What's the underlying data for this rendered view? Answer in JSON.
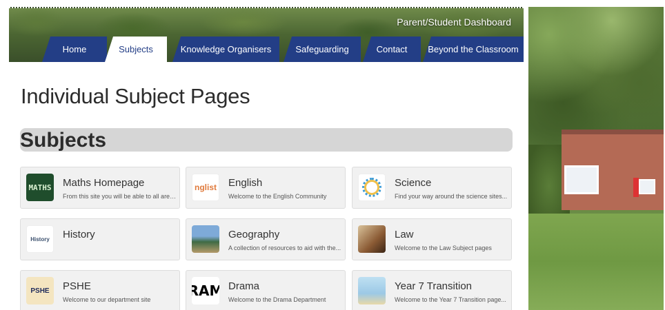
{
  "header": {
    "dashboard_link": "Parent/Student Dashboard",
    "nav": [
      {
        "label": "Home",
        "active": false
      },
      {
        "label": "Subjects",
        "active": true
      },
      {
        "label": "Knowledge Organisers",
        "active": false
      },
      {
        "label": "Safeguarding",
        "active": false
      },
      {
        "label": "Contact",
        "active": false
      },
      {
        "label": "Beyond the Classroom",
        "active": false
      }
    ]
  },
  "main": {
    "page_title": "Individual Subject Pages",
    "section_title": "Subjects",
    "cards": [
      {
        "title": "Maths Homepage",
        "desc": "From this site you will be able to all areas...",
        "thumb_text": "MATHS",
        "icon": "maths-chalkboard-icon"
      },
      {
        "title": "English",
        "desc": "Welcome to the English Community",
        "thumb_text": "nglist",
        "icon": "english-word-icon"
      },
      {
        "title": "Science",
        "desc": "Find your way around the science sites...",
        "thumb_text": "",
        "icon": "science-circle-icon"
      },
      {
        "title": "History",
        "desc": "",
        "thumb_text": "History",
        "icon": "history-collage-icon"
      },
      {
        "title": "Geography",
        "desc": "A collection of resources to aid with the...",
        "thumb_text": "",
        "icon": "geography-landscape-icon"
      },
      {
        "title": "Law",
        "desc": "Welcome to the Law Subject pages",
        "thumb_text": "",
        "icon": "law-gavel-icon"
      },
      {
        "title": "PSHE",
        "desc": "Welcome to our department site",
        "thumb_text": "PSHE",
        "icon": "pshe-puzzle-icon"
      },
      {
        "title": "Drama",
        "desc": "Welcome to the Drama Department",
        "thumb_text": "RAM",
        "icon": "drama-letters-icon"
      },
      {
        "title": "Year 7 Transition",
        "desc": "Welcome to the Year 7 Transition page...",
        "thumb_text": "",
        "icon": "year7-figures-icon"
      }
    ]
  },
  "colors": {
    "nav_blue": "#233e86",
    "section_bar": "#d6d6d6",
    "card_bg": "#f1f1f1"
  }
}
